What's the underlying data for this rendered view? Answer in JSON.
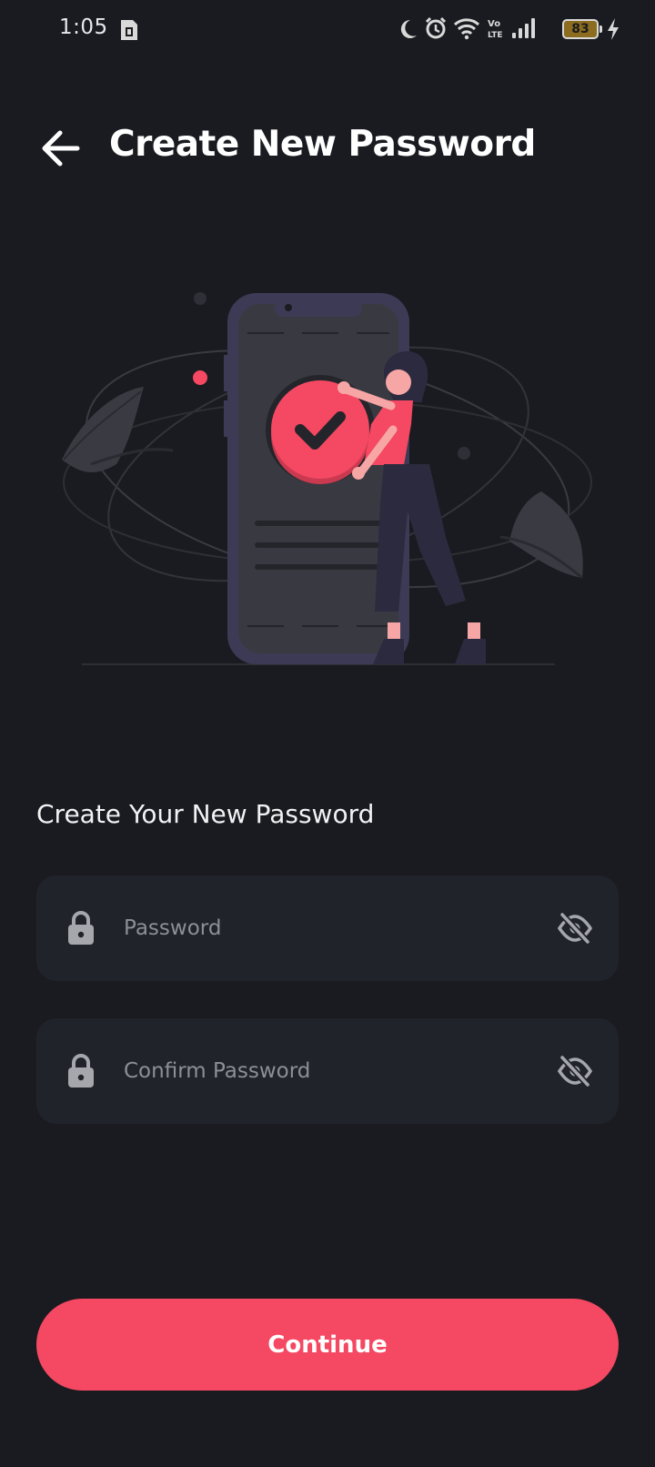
{
  "status_bar": {
    "time": "1:05",
    "battery_level": "83",
    "icons": [
      "sim-card-icon",
      "moon-icon",
      "alarm-icon",
      "wifi-icon",
      "volte-icon",
      "signal-icon",
      "battery-icon",
      "charging-icon"
    ]
  },
  "header": {
    "title": "Create New Password",
    "back_icon": "arrow-left-icon"
  },
  "form": {
    "section_title": "Create Your New Password",
    "password_placeholder": "Password",
    "confirm_placeholder": "Confirm Password",
    "lock_icon": "lock-icon",
    "eye_icon": "eye-off-icon"
  },
  "actions": {
    "continue_label": "Continue"
  },
  "colors": {
    "background": "#1a1b20",
    "field_background": "#21232b",
    "accent": "#f54862"
  }
}
